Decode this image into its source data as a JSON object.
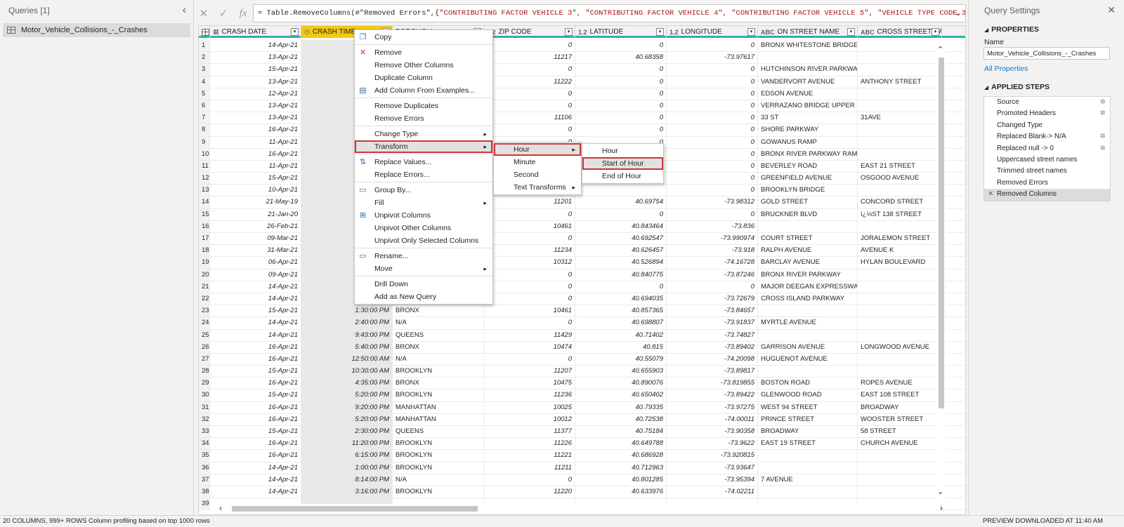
{
  "queries": {
    "header": "Queries [1]",
    "items": [
      "Motor_Vehicle_Collisions_-_Crashes"
    ]
  },
  "formula": {
    "prefix": "= Table.RemoveColumns(#\"Removed Errors\",{",
    "strings": "\"CONTRIBUTING FACTOR VEHICLE 3\", \"CONTRIBUTING FACTOR VEHICLE 4\", \"CONTRIBUTING FACTOR VEHICLE 5\", \"VEHICLE TYPE CODE 3\", \"VEHICLE"
  },
  "columns": [
    {
      "type": "",
      "name": "CRASH DATE"
    },
    {
      "type": "",
      "name": "CRASH TIME"
    },
    {
      "type": "",
      "name": "BOROUGH"
    },
    {
      "type": "1.2",
      "name": "ZIP CODE"
    },
    {
      "type": "1.2",
      "name": "LATITUDE"
    },
    {
      "type": "1.2",
      "name": "LONGITUDE"
    },
    {
      "type": "ABC",
      "name": "ON STREET NAME"
    },
    {
      "type": "ABC",
      "name": "CROSS STREET NAME"
    }
  ],
  "rows": [
    [
      "1",
      "14-Apr-21",
      "",
      "",
      "0",
      "0",
      "0",
      "BRONX WHITESTONE BRIDGE",
      ""
    ],
    [
      "2",
      "13-Apr-21",
      "",
      "",
      "11217",
      "40.68358",
      "-73.97617",
      "",
      ""
    ],
    [
      "3",
      "15-Apr-21",
      "",
      "",
      "0",
      "0",
      "0",
      "HUTCHINSON RIVER PARKWAY",
      ""
    ],
    [
      "4",
      "13-Apr-21",
      "",
      "",
      "11222",
      "0",
      "0",
      "VANDERVORT AVENUE",
      "ANTHONY STREET"
    ],
    [
      "5",
      "12-Apr-21",
      "",
      "",
      "0",
      "0",
      "0",
      "EDSON AVENUE",
      ""
    ],
    [
      "6",
      "13-Apr-21",
      "",
      "",
      "0",
      "0",
      "0",
      "VERRAZANO BRIDGE UPPER",
      ""
    ],
    [
      "7",
      "13-Apr-21",
      "",
      "",
      "11106",
      "0",
      "0",
      "33 ST",
      "31AVE"
    ],
    [
      "8",
      "16-Apr-21",
      "",
      "",
      "0",
      "0",
      "0",
      "SHORE PARKWAY",
      ""
    ],
    [
      "9",
      "11-Apr-21",
      "",
      "",
      "0",
      "0",
      "0",
      "GOWANUS RAMP",
      ""
    ],
    [
      "10",
      "16-Apr-21",
      "",
      "",
      "",
      "",
      "0",
      "BRONX RIVER PARKWAY RAMP",
      ""
    ],
    [
      "11",
      "11-Apr-21",
      "",
      "",
      "",
      "",
      "0",
      "BEVERLEY ROAD",
      "EAST 21 STREET"
    ],
    [
      "12",
      "15-Apr-21",
      "",
      "",
      "",
      "",
      "0",
      "GREENFIELD AVENUE",
      "OSGOOD AVENUE"
    ],
    [
      "13",
      "10-Apr-21",
      "",
      "",
      "",
      "",
      "0",
      "BROOKLYN BRIDGE",
      ""
    ],
    [
      "14",
      "21-May-19",
      "",
      "",
      "11201",
      "40.69754",
      "-73.98312",
      "GOLD STREET",
      "CONCORD STREET"
    ],
    [
      "15",
      "21-Jan-20",
      "",
      "",
      "0",
      "0",
      "0",
      "BRUCKNER BLVD",
      "ï¿½ST 138 STREET"
    ],
    [
      "16",
      "26-Feb-21",
      "",
      "",
      "10461",
      "40.843464",
      "-73.836",
      "",
      ""
    ],
    [
      "17",
      "09-Mar-21",
      "",
      "",
      "0",
      "40.692547",
      "-73.990974",
      "COURT STREET",
      "JORALEMON STREET"
    ],
    [
      "18",
      "31-Mar-21",
      "",
      "",
      "11234",
      "40.626457",
      "-73.918",
      "RALPH AVENUE",
      "AVENUE K"
    ],
    [
      "19",
      "06-Apr-21",
      "",
      "",
      "10312",
      "40.526894",
      "-74.16728",
      "BARCLAY AVENUE",
      "HYLAN BOULEVARD"
    ],
    [
      "20",
      "09-Apr-21",
      "",
      "",
      "0",
      "40.840775",
      "-73.87246",
      "BRONX RIVER PARKWAY",
      ""
    ],
    [
      "21",
      "14-Apr-21",
      "",
      "",
      "0",
      "0",
      "0",
      "MAJOR DEEGAN EXPRESSWAY R...",
      ""
    ],
    [
      "22",
      "14-Apr-21",
      "",
      "",
      "0",
      "40.694035",
      "-73.72679",
      "CROSS ISLAND PARKWAY",
      ""
    ],
    [
      "23",
      "15-Apr-21",
      "1:30:00 PM",
      "BRONX",
      "10461",
      "40.857365",
      "-73.84657",
      "",
      ""
    ],
    [
      "24",
      "14-Apr-21",
      "2:40:00 PM",
      "N/A",
      "0",
      "40.698807",
      "-73.91837",
      "MYRTLE AVENUE",
      ""
    ],
    [
      "25",
      "14-Apr-21",
      "9:43:00 PM",
      "QUEENS",
      "11429",
      "40.71402",
      "-73.74827",
      "",
      ""
    ],
    [
      "26",
      "16-Apr-21",
      "5:40:00 PM",
      "BRONX",
      "10474",
      "40.815",
      "-73.89402",
      "GARRISON AVENUE",
      "LONGWOOD AVENUE"
    ],
    [
      "27",
      "16-Apr-21",
      "12:50:00 AM",
      "N/A",
      "0",
      "40.55079",
      "-74.20098",
      "HUGUENOT AVENUE",
      ""
    ],
    [
      "28",
      "15-Apr-21",
      "10:30:00 AM",
      "BROOKLYN",
      "11207",
      "40.655903",
      "-73.89817",
      "",
      ""
    ],
    [
      "29",
      "16-Apr-21",
      "4:35:00 PM",
      "BRONX",
      "10475",
      "40.890076",
      "-73.819855",
      "BOSTON ROAD",
      "ROPES AVENUE"
    ],
    [
      "30",
      "15-Apr-21",
      "5:20:00 PM",
      "BROOKLYN",
      "11236",
      "40.650402",
      "-73.89422",
      "GLENWOOD ROAD",
      "EAST 108 STREET"
    ],
    [
      "31",
      "16-Apr-21",
      "9:20:00 PM",
      "MANHATTAN",
      "10025",
      "40.79335",
      "-73.97275",
      "WEST 94 STREET",
      "BROADWAY"
    ],
    [
      "32",
      "16-Apr-21",
      "5:20:00 PM",
      "MANHATTAN",
      "10012",
      "40.72538",
      "-74.00011",
      "PRINCE STREET",
      "WOOSTER STREET"
    ],
    [
      "33",
      "15-Apr-21",
      "2:30:00 PM",
      "QUEENS",
      "11377",
      "40.75184",
      "-73.90358",
      "BROADWAY",
      "58 STREET"
    ],
    [
      "34",
      "16-Apr-21",
      "11:20:00 PM",
      "BROOKLYN",
      "11226",
      "40.649788",
      "-73.9622",
      "EAST 19 STREET",
      "CHURCH AVENUE"
    ],
    [
      "35",
      "16-Apr-21",
      "6:15:00 PM",
      "BROOKLYN",
      "11221",
      "40.686928",
      "-73.920815",
      "",
      ""
    ],
    [
      "36",
      "14-Apr-21",
      "1:00:00 PM",
      "BROOKLYN",
      "11211",
      "40.712963",
      "-73.93647",
      "",
      ""
    ],
    [
      "37",
      "14-Apr-21",
      "8:14:00 PM",
      "N/A",
      "0",
      "40.801285",
      "-73.95394",
      "7 AVENUE",
      ""
    ],
    [
      "38",
      "14-Apr-21",
      "3:16:00 PM",
      "BROOKLYN",
      "11220",
      "40.633976",
      "-74.02211",
      "",
      ""
    ],
    [
      "39",
      "",
      "",
      "",
      "",
      "",
      "",
      "",
      ""
    ]
  ],
  "context_menu": {
    "items": [
      {
        "label": "Copy",
        "icon": "copy-icon"
      },
      {
        "sep": true
      },
      {
        "label": "Remove",
        "icon": "remove-icon"
      },
      {
        "label": "Remove Other Columns"
      },
      {
        "label": "Duplicate Column"
      },
      {
        "label": "Add Column From Examples...",
        "icon": "examples-icon"
      },
      {
        "sep": true
      },
      {
        "label": "Remove Duplicates"
      },
      {
        "label": "Remove Errors"
      },
      {
        "sep": true
      },
      {
        "label": "Change Type",
        "submenu": true
      },
      {
        "label": "Transform",
        "submenu": true,
        "highlight": true
      },
      {
        "sep": true
      },
      {
        "label": "Replace Values...",
        "icon": "replace-icon"
      },
      {
        "label": "Replace Errors..."
      },
      {
        "sep": true
      },
      {
        "label": "Group By...",
        "icon": "group-icon"
      },
      {
        "label": "Fill",
        "submenu": true
      },
      {
        "label": "Unpivot Columns",
        "icon": "unpivot-icon"
      },
      {
        "label": "Unpivot Other Columns"
      },
      {
        "label": "Unpivot Only Selected Columns"
      },
      {
        "sep": true
      },
      {
        "label": "Rename...",
        "icon": "rename-icon"
      },
      {
        "label": "Move",
        "submenu": true
      },
      {
        "sep": true
      },
      {
        "label": "Drill Down"
      },
      {
        "label": "Add as New Query"
      }
    ]
  },
  "transform_menu": {
    "items": [
      {
        "label": "Hour",
        "submenu": true,
        "highlight": true
      },
      {
        "label": "Minute"
      },
      {
        "label": "Second"
      },
      {
        "label": "Text Transforms",
        "submenu": true
      }
    ]
  },
  "hour_menu": {
    "items": [
      {
        "label": "Hour"
      },
      {
        "label": "Start of Hour",
        "highlight": true
      },
      {
        "label": "End of Hour"
      }
    ]
  },
  "settings": {
    "title": "Query Settings",
    "properties_title": "PROPERTIES",
    "name_label": "Name",
    "name_value": "Motor_Vehicle_Collisions_-_Crashes",
    "all_properties": "All Properties",
    "applied_steps_title": "APPLIED STEPS",
    "steps": [
      {
        "label": "Source",
        "gear": true
      },
      {
        "label": "Promoted Headers",
        "gear": true
      },
      {
        "label": "Changed Type"
      },
      {
        "label": "Replaced Blank-> N/A",
        "gear": true
      },
      {
        "label": "Replaced null -> 0",
        "gear": true
      },
      {
        "label": "Uppercased street names"
      },
      {
        "label": "Trimmed street names"
      },
      {
        "label": "Removed Errors"
      },
      {
        "label": "Removed Columns",
        "active": true
      }
    ]
  },
  "status": {
    "left": "20 COLUMNS, 999+ ROWS",
    "mid": "Column profiling based on top 1000 rows",
    "right": "PREVIEW DOWNLOADED AT 11:40 AM"
  }
}
